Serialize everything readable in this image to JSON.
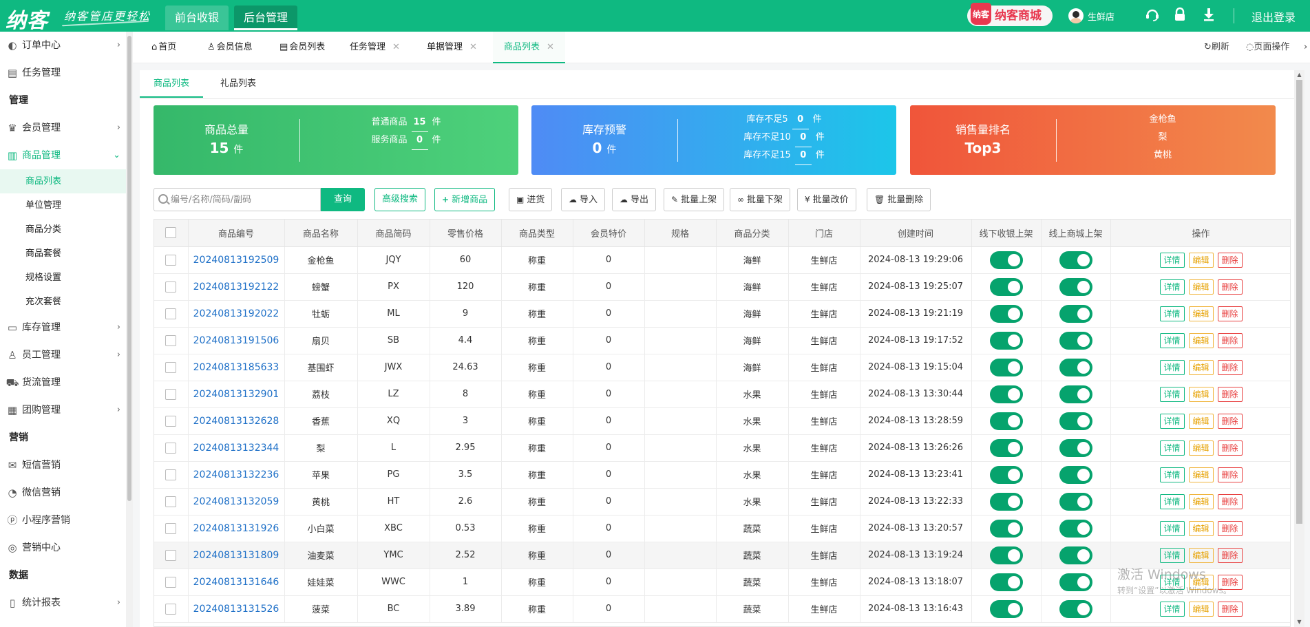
{
  "topbar": {
    "logo": "纳客",
    "slogan": "纳客管店更轻松",
    "nav": [
      "前台收银",
      "后台管理"
    ],
    "mall_badge": "纳客商城",
    "mall_bag_text": "纳客",
    "user": "生鲜店",
    "logout": "退出登录",
    "colors": {
      "brand": "#0fb981"
    }
  },
  "sidebar": {
    "items": [
      {
        "type": "item",
        "label": "订单中心",
        "icon": "order-icon",
        "arrow": true
      },
      {
        "type": "item",
        "label": "任务管理",
        "icon": "task-icon",
        "arrow": false
      },
      {
        "type": "group",
        "label": "管理"
      },
      {
        "type": "item",
        "label": "会员管理",
        "icon": "crown-icon",
        "arrow": true
      },
      {
        "type": "item",
        "label": "商品管理",
        "icon": "product-icon",
        "arrow": true,
        "expanded": true,
        "active": true
      },
      {
        "type": "sub",
        "label": "商品列表",
        "active": true
      },
      {
        "type": "sub",
        "label": "单位管理"
      },
      {
        "type": "sub",
        "label": "商品分类"
      },
      {
        "type": "sub",
        "label": "商品套餐"
      },
      {
        "type": "sub",
        "label": "规格设置"
      },
      {
        "type": "sub",
        "label": "充次套餐"
      },
      {
        "type": "item",
        "label": "库存管理",
        "icon": "inventory-icon",
        "arrow": true
      },
      {
        "type": "item",
        "label": "员工管理",
        "icon": "staff-icon",
        "arrow": true
      },
      {
        "type": "item",
        "label": "货流管理",
        "icon": "truck-icon",
        "arrow": false
      },
      {
        "type": "item",
        "label": "团购管理",
        "icon": "groupbuy-icon",
        "arrow": true
      },
      {
        "type": "group",
        "label": "营销"
      },
      {
        "type": "item",
        "label": "短信营销",
        "icon": "mail-icon",
        "arrow": false
      },
      {
        "type": "item",
        "label": "微信营销",
        "icon": "wechat-icon",
        "arrow": false
      },
      {
        "type": "item",
        "label": "小程序营销",
        "icon": "miniprogram-icon",
        "arrow": false
      },
      {
        "type": "item",
        "label": "营销中心",
        "icon": "target-icon",
        "arrow": false
      },
      {
        "type": "group",
        "label": "数据"
      },
      {
        "type": "item",
        "label": "统计报表",
        "icon": "chart-icon",
        "arrow": true
      }
    ]
  },
  "tabs": {
    "items": [
      {
        "label": "首页",
        "icon": "home-icon",
        "closable": false
      },
      {
        "label": "会员信息",
        "icon": "user-icon",
        "closable": false
      },
      {
        "label": "会员列表",
        "icon": "clipboard-icon",
        "closable": false
      },
      {
        "label": "任务管理",
        "closable": true
      },
      {
        "label": "单据管理",
        "closable": true
      },
      {
        "label": "商品列表",
        "closable": true,
        "active": true
      }
    ],
    "refresh": "刷新",
    "page_ops": "页面操作"
  },
  "subtabs": [
    "商品列表",
    "礼品列表"
  ],
  "cards": {
    "green": {
      "label": "商品总量",
      "value": "15",
      "unit": "件",
      "rows": [
        {
          "label": "普通商品",
          "value": "15",
          "unit": "件"
        },
        {
          "label": "服务商品",
          "value": "0",
          "unit": "件"
        }
      ]
    },
    "blue": {
      "label": "库存预警",
      "value": "0",
      "unit": "件",
      "rows": [
        {
          "label": "库存不足5",
          "value": "0",
          "unit": "件"
        },
        {
          "label": "库存不足10",
          "value": "0",
          "unit": "件"
        },
        {
          "label": "库存不足15",
          "value": "0",
          "unit": "件"
        }
      ]
    },
    "orange": {
      "label": "销售量排名",
      "value": "Top3",
      "rows": [
        "金枪鱼",
        "梨",
        "黄桃"
      ]
    }
  },
  "toolbar": {
    "search_placeholder": "编号/名称/简码/副码",
    "query": "查询",
    "advanced": "高级搜索",
    "add": "新增商品",
    "stock_in": "进货",
    "import": "导入",
    "export": "导出",
    "batch_on": "批量上架",
    "batch_off": "批量下架",
    "batch_price": "批量改价",
    "batch_delete": "批量删除"
  },
  "table": {
    "headers": [
      "商品编号",
      "商品名称",
      "商品简码",
      "零售价格",
      "商品类型",
      "会员特价",
      "规格",
      "商品分类",
      "门店",
      "创建时间",
      "线下收银上架",
      "线上商城上架",
      "操作"
    ],
    "ops": {
      "detail": "详情",
      "edit": "编辑",
      "delete": "删除"
    },
    "rows": [
      {
        "code": "20240813192509",
        "name": "金枪鱼",
        "abbr": "JQY",
        "price": "60",
        "type": "称重",
        "member_price": "0",
        "spec": "",
        "category": "海鲜",
        "store": "生鲜店",
        "created": "2024-08-13 19:29:06",
        "offline": true,
        "online": true
      },
      {
        "code": "20240813192122",
        "name": "螃蟹",
        "abbr": "PX",
        "price": "120",
        "type": "称重",
        "member_price": "0",
        "spec": "",
        "category": "海鲜",
        "store": "生鲜店",
        "created": "2024-08-13 19:25:07",
        "offline": true,
        "online": true
      },
      {
        "code": "20240813192022",
        "name": "牡蛎",
        "abbr": "ML",
        "price": "9",
        "type": "称重",
        "member_price": "0",
        "spec": "",
        "category": "海鲜",
        "store": "生鲜店",
        "created": "2024-08-13 19:21:19",
        "offline": true,
        "online": true
      },
      {
        "code": "20240813191506",
        "name": "扇贝",
        "abbr": "SB",
        "price": "4.4",
        "type": "称重",
        "member_price": "0",
        "spec": "",
        "category": "海鲜",
        "store": "生鲜店",
        "created": "2024-08-13 19:17:52",
        "offline": true,
        "online": true
      },
      {
        "code": "20240813185633",
        "name": "基围虾",
        "abbr": "JWX",
        "price": "24.63",
        "type": "称重",
        "member_price": "0",
        "spec": "",
        "category": "海鲜",
        "store": "生鲜店",
        "created": "2024-08-13 19:15:04",
        "offline": true,
        "online": true
      },
      {
        "code": "20240813132901",
        "name": "荔枝",
        "abbr": "LZ",
        "price": "8",
        "type": "称重",
        "member_price": "0",
        "spec": "",
        "category": "水果",
        "store": "生鲜店",
        "created": "2024-08-13 13:30:44",
        "offline": true,
        "online": true
      },
      {
        "code": "20240813132628",
        "name": "香蕉",
        "abbr": "XQ",
        "price": "3",
        "type": "称重",
        "member_price": "0",
        "spec": "",
        "category": "水果",
        "store": "生鲜店",
        "created": "2024-08-13 13:28:59",
        "offline": true,
        "online": true
      },
      {
        "code": "20240813132344",
        "name": "梨",
        "abbr": "L",
        "price": "2.95",
        "type": "称重",
        "member_price": "0",
        "spec": "",
        "category": "水果",
        "store": "生鲜店",
        "created": "2024-08-13 13:26:26",
        "offline": true,
        "online": true
      },
      {
        "code": "20240813132236",
        "name": "苹果",
        "abbr": "PG",
        "price": "3.5",
        "type": "称重",
        "member_price": "0",
        "spec": "",
        "category": "水果",
        "store": "生鲜店",
        "created": "2024-08-13 13:23:41",
        "offline": true,
        "online": true
      },
      {
        "code": "20240813132059",
        "name": "黄桃",
        "abbr": "HT",
        "price": "2.6",
        "type": "称重",
        "member_price": "0",
        "spec": "",
        "category": "水果",
        "store": "生鲜店",
        "created": "2024-08-13 13:22:33",
        "offline": true,
        "online": true
      },
      {
        "code": "20240813131926",
        "name": "小白菜",
        "abbr": "XBC",
        "price": "0.53",
        "type": "称重",
        "member_price": "0",
        "spec": "",
        "category": "蔬菜",
        "store": "生鲜店",
        "created": "2024-08-13 13:20:57",
        "offline": true,
        "online": true
      },
      {
        "code": "20240813131809",
        "name": "油麦菜",
        "abbr": "YMC",
        "price": "2.52",
        "type": "称重",
        "member_price": "0",
        "spec": "",
        "category": "蔬菜",
        "store": "生鲜店",
        "created": "2024-08-13 13:19:24",
        "offline": true,
        "online": true,
        "highlight": true
      },
      {
        "code": "20240813131646",
        "name": "娃娃菜",
        "abbr": "WWC",
        "price": "1",
        "type": "称重",
        "member_price": "0",
        "spec": "",
        "category": "蔬菜",
        "store": "生鲜店",
        "created": "2024-08-13 13:18:07",
        "offline": true,
        "online": true
      },
      {
        "code": "20240813131526",
        "name": "菠菜",
        "abbr": "BC",
        "price": "3.89",
        "type": "称重",
        "member_price": "0",
        "spec": "",
        "category": "蔬菜",
        "store": "生鲜店",
        "created": "2024-08-13 13:16:43",
        "offline": true,
        "online": true
      }
    ]
  },
  "watermark": {
    "line1": "激活 Windows",
    "line2": "转到“设置”以激活 Windows。"
  }
}
